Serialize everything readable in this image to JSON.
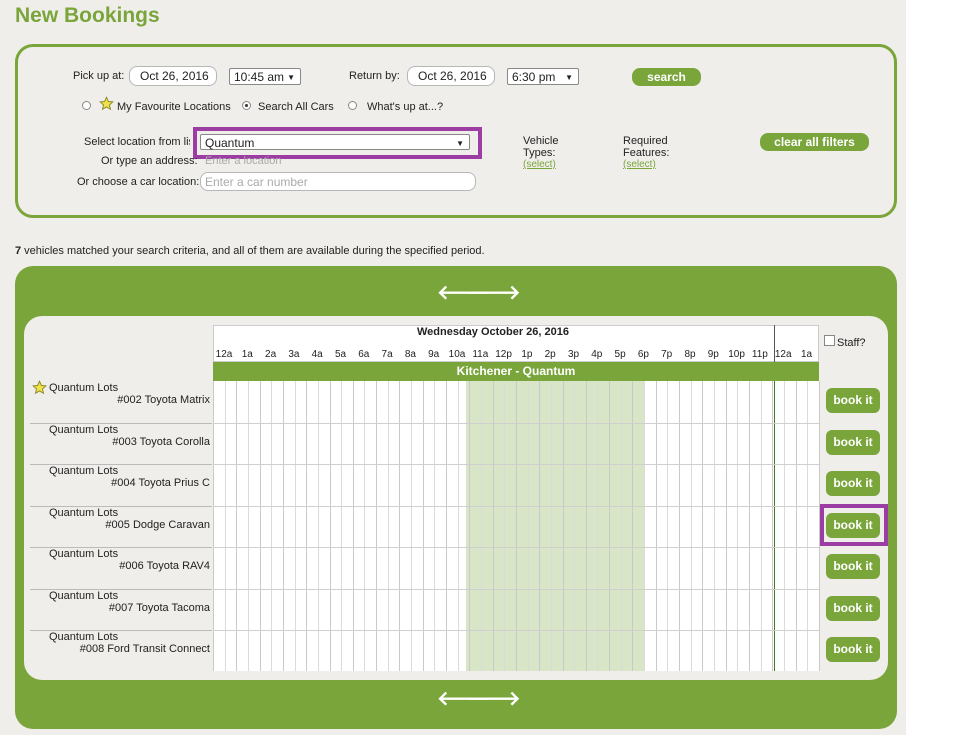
{
  "page": {
    "title": "New Bookings"
  },
  "search": {
    "pickup_label": "Pick up at:",
    "pickup_date": "Oct 26, 2016",
    "pickup_time": "10:45 am",
    "return_label": "Return by:",
    "return_date": "Oct 26, 2016",
    "return_time": "6:30 pm",
    "search_button": "search",
    "options": [
      {
        "label": "My Favourite Locations",
        "selected": false
      },
      {
        "label": "Search All Cars",
        "selected": true
      },
      {
        "label": "What's up at...?",
        "selected": false
      }
    ],
    "location_list_label": "Select location from list",
    "location_list_value": "Quantum",
    "address_label": "Or type an address:",
    "address_placeholder": "Enter a location",
    "car_location_label": "Or choose a car location:",
    "car_location_placeholder": "Enter a car number",
    "vehicle_types_label1": "Vehicle",
    "vehicle_types_label2": "Types:",
    "vehicle_types_link": "(select)",
    "features_label1": "Required",
    "features_label2": "Features:",
    "features_link": "(select)",
    "clear_button": "clear all filters"
  },
  "results": {
    "summary_count": "7",
    "summary_text": " vehicles matched your search criteria, and all of them are available during the specified period.",
    "date_heading": "Wednesday October 26, 2016",
    "hours": [
      "12a",
      "1a",
      "2a",
      "3a",
      "4a",
      "5a",
      "6a",
      "7a",
      "8a",
      "9a",
      "10a",
      "11a",
      "12p",
      "1p",
      "2p",
      "3p",
      "4p",
      "5p",
      "6p",
      "7p",
      "8p",
      "9p",
      "10p",
      "11p",
      "12a",
      "1a"
    ],
    "staff_label": "Staff?",
    "location_band": "Kitchener - Quantum",
    "book_label": "book it",
    "vehicles": [
      {
        "location": "Quantum Lots",
        "name": "#002 Toyota Matrix",
        "favourite": true
      },
      {
        "location": "Quantum Lots",
        "name": "#003 Toyota Corolla",
        "favourite": false
      },
      {
        "location": "Quantum Lots",
        "name": "#004 Toyota Prius C",
        "favourite": false
      },
      {
        "location": "Quantum Lots",
        "name": "#005 Dodge Caravan",
        "favourite": false
      },
      {
        "location": "Quantum Lots",
        "name": "#006 Toyota RAV4",
        "favourite": false
      },
      {
        "location": "Quantum Lots",
        "name": "#007 Toyota Tacoma",
        "favourite": false
      },
      {
        "location": "Quantum Lots",
        "name": "#008 Ford Transit Connect",
        "favourite": false
      }
    ]
  },
  "colors": {
    "brand": "#7aa53b",
    "highlight": "#9b3da2",
    "shade": "#d8e6c7"
  },
  "icons": {
    "favourite": "star-icon",
    "prev": "arrow-left-icon",
    "next": "arrow-right-icon"
  }
}
